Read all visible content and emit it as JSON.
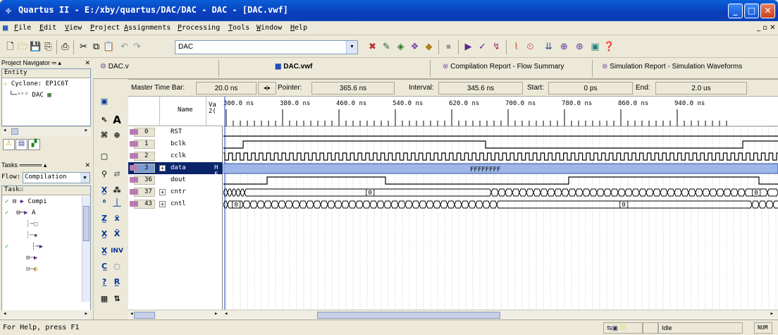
{
  "window": {
    "title": "Quartus II - E:/xby/quartus/DAC/DAC - DAC - [DAC.vwf]"
  },
  "menu": [
    {
      "label": "File",
      "key": "F"
    },
    {
      "label": "Edit",
      "key": "E"
    },
    {
      "label": "View",
      "key": "V"
    },
    {
      "label": "Project",
      "key": "P"
    },
    {
      "label": "Assignments",
      "key": "A"
    },
    {
      "label": "Processing",
      "key": "P"
    },
    {
      "label": "Tools",
      "key": "T"
    },
    {
      "label": "Window",
      "key": "W"
    },
    {
      "label": "Help",
      "key": "H"
    }
  ],
  "toolbar": {
    "combo_value": "DAC"
  },
  "navigator": {
    "title": "Project Navigator",
    "column": "Entity",
    "device": "Cyclone: EP1C6T",
    "entity": "DAC"
  },
  "tasks": {
    "title": "Tasks",
    "flow_label": "Flow:",
    "flow_value": "Compilation",
    "column": "Task",
    "first_task": "Compi",
    "second_task": "A"
  },
  "doc_tabs": [
    {
      "label": "DAC.v",
      "active": false
    },
    {
      "label": "DAC.vwf",
      "active": true
    },
    {
      "label": "Compilation Report - Flow Summary",
      "active": false
    },
    {
      "label": "Simulation Report - Simulation Waveforms",
      "active": false
    }
  ],
  "time_bar": {
    "master_label": "Master Time Bar:",
    "master_value": "20.0 ns",
    "pointer_label": "Pointer:",
    "pointer_value": "365.6 ns",
    "interval_label": "Interval:",
    "interval_value": "345.6 ns",
    "start_label": "Start:",
    "start_value": "0 ps",
    "end_label": "End:",
    "end_value": "2.0 us"
  },
  "columns": {
    "name": "Name",
    "value": "Va\n2("
  },
  "time_ticks": [
    "300.0 ns",
    "380.0 ns",
    "460.0 ns",
    "540.0 ns",
    "620.0 ns",
    "700.0 ns",
    "780.0 ns",
    "860.0 ns",
    "940.0 ns"
  ],
  "signals": [
    {
      "num": "0",
      "name": "RST",
      "value": "",
      "expand": false,
      "selected": false
    },
    {
      "num": "1",
      "name": "bclk",
      "value": "",
      "expand": false,
      "selected": false
    },
    {
      "num": "2",
      "name": "cclk",
      "value": "",
      "expand": false,
      "selected": false
    },
    {
      "num": "3",
      "name": "data",
      "value": "H F",
      "expand": true,
      "selected": true
    },
    {
      "num": "36",
      "name": "dout",
      "value": "",
      "expand": false,
      "selected": false
    },
    {
      "num": "37",
      "name": "cntr",
      "value": "",
      "expand": true,
      "selected": false
    },
    {
      "num": "43",
      "name": "cntl",
      "value": "",
      "expand": true,
      "selected": false
    }
  ],
  "wave_labels": {
    "data": "FFFFFFFF",
    "cntr_zero": "[0]",
    "cntl_zero_a": "[0]",
    "cntl_zero_b": "[0]",
    "cntr_zero_b": "[0]"
  },
  "status": {
    "help": "For Help, press F1",
    "idle": "Idle",
    "num": "NUM"
  }
}
